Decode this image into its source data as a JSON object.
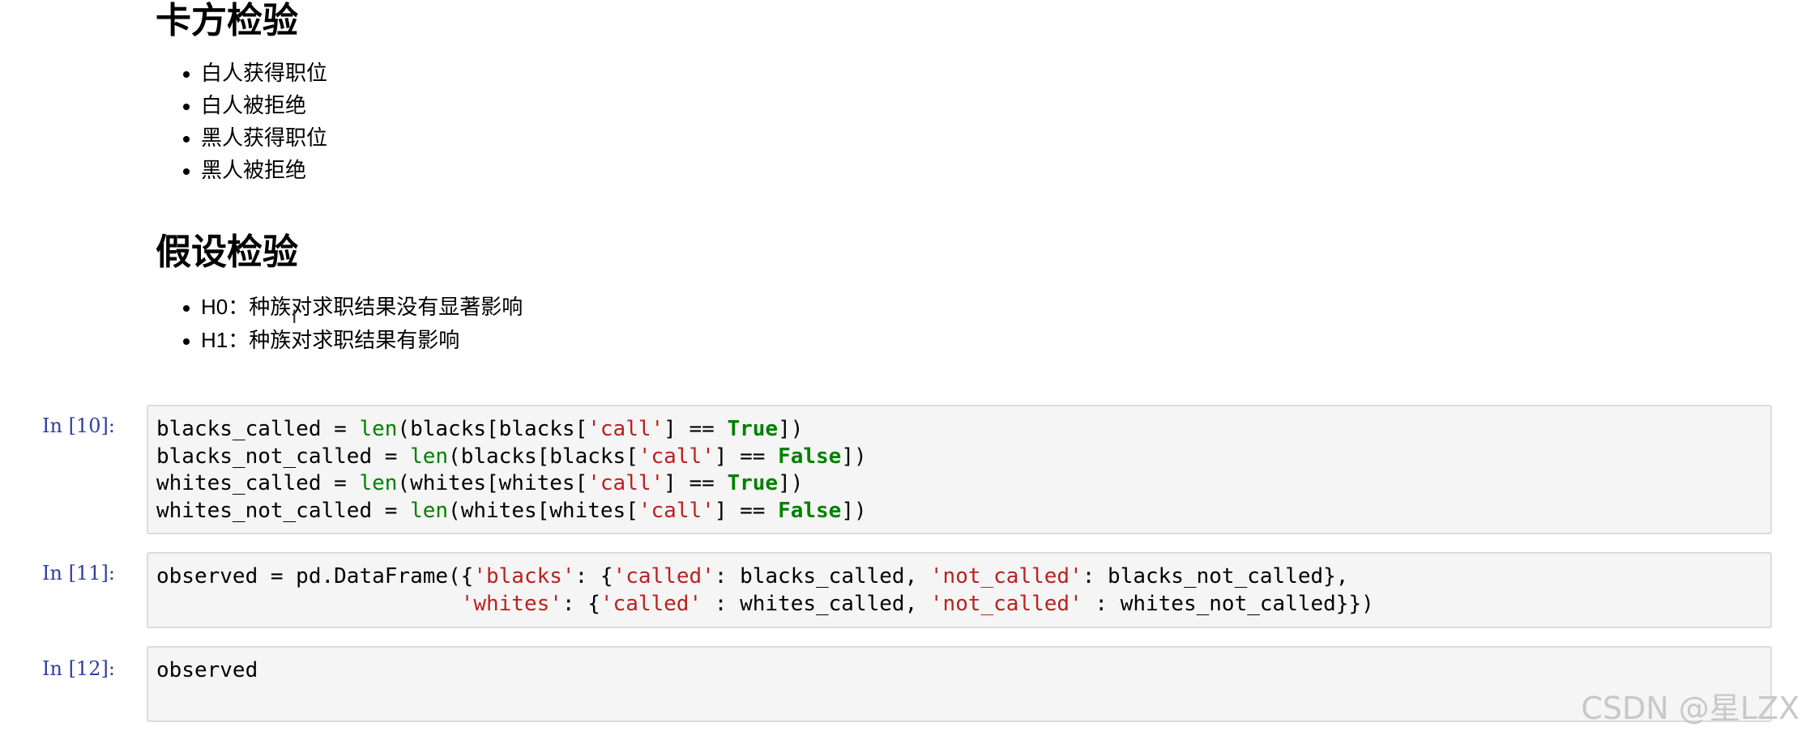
{
  "sections": [
    {
      "title": "卡方检验",
      "items": [
        "白人获得职位",
        "白人被拒绝",
        "黑人获得职位",
        "黑人被拒绝"
      ]
    },
    {
      "title": "假设检验",
      "items": [
        {
          "label": "H0",
          "sep": "：",
          "text": "种族对求职结果没有显著影响"
        },
        {
          "label": "H1",
          "sep": "：",
          "text": "种族对求职结果有影响"
        }
      ]
    }
  ],
  "cells": [
    {
      "prompt": "In [10]:",
      "lines": [
        [
          [
            "",
            "blacks_called = "
          ],
          [
            "bi",
            "len"
          ],
          [
            "",
            "(blacks[blacks["
          ],
          [
            "st",
            "'call'"
          ],
          [
            "",
            "] == "
          ],
          [
            "kw",
            "True"
          ],
          [
            "",
            "])"
          ]
        ],
        [
          [
            "",
            "blacks_not_called = "
          ],
          [
            "bi",
            "len"
          ],
          [
            "",
            "(blacks[blacks["
          ],
          [
            "st",
            "'call'"
          ],
          [
            "",
            "] == "
          ],
          [
            "kw",
            "False"
          ],
          [
            "",
            "])"
          ]
        ],
        [
          [
            "",
            "whites_called = "
          ],
          [
            "bi",
            "len"
          ],
          [
            "",
            "(whites[whites["
          ],
          [
            "st",
            "'call'"
          ],
          [
            "",
            "] == "
          ],
          [
            "kw",
            "True"
          ],
          [
            "",
            "])"
          ]
        ],
        [
          [
            "",
            "whites_not_called = "
          ],
          [
            "bi",
            "len"
          ],
          [
            "",
            "(whites[whites["
          ],
          [
            "st",
            "'call'"
          ],
          [
            "",
            "] == "
          ],
          [
            "kw",
            "False"
          ],
          [
            "",
            "])"
          ]
        ]
      ]
    },
    {
      "prompt": "In [11]:",
      "lines": [
        [
          [
            "",
            "observed = pd.DataFrame({"
          ],
          [
            "st",
            "'blacks'"
          ],
          [
            "",
            ": {"
          ],
          [
            "st",
            "'called'"
          ],
          [
            "",
            ": blacks_called, "
          ],
          [
            "st",
            "'not_called'"
          ],
          [
            "",
            ": blacks_not_called},"
          ]
        ],
        [
          [
            "",
            "                        "
          ],
          [
            "st",
            "'whites'"
          ],
          [
            "",
            ": {"
          ],
          [
            "st",
            "'called'"
          ],
          [
            "",
            " : whites_called, "
          ],
          [
            "st",
            "'not_called'"
          ],
          [
            "",
            " : whites_not_called}})"
          ]
        ]
      ]
    },
    {
      "prompt": "In [12]:",
      "lines": [
        [
          [
            "",
            "observed"
          ]
        ]
      ]
    }
  ],
  "watermark": "CSDN @星LZX"
}
